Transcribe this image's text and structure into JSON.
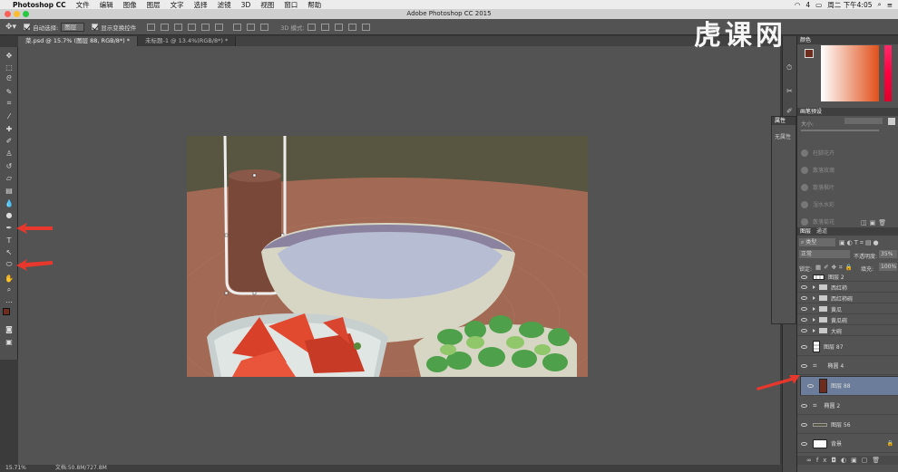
{
  "menubar": {
    "app": "Photoshop CC",
    "items": [
      "文件",
      "编辑",
      "图像",
      "图层",
      "文字",
      "选择",
      "滤镜",
      "3D",
      "视图",
      "窗口",
      "帮助"
    ],
    "status_icon_label": "4",
    "clock": "周二 下午4:05"
  },
  "window": {
    "title": "Adobe Photoshop CC 2015"
  },
  "options": {
    "auto_select_label": "自动选择:",
    "auto_select_value": "图层",
    "show_transform_label": "显示变换控件",
    "mode_3d_label": "3D 模式:"
  },
  "tabs": [
    {
      "label": "菜.psd @ 15.7% (图层 88, RGB/8*) *"
    },
    {
      "label": "未标题-1 @ 13.4%(RGB/8*) *"
    }
  ],
  "status": {
    "zoom": "15.71%",
    "doc": "文档:50.8M/727.8M"
  },
  "watermark": {
    "text": "虎课网"
  },
  "panels": {
    "color_tab": "颜色",
    "brush_preset_tab": "画笔预设",
    "size_label": "大小:",
    "brush_presets": [
      "柱脚花卉",
      "散落玫瑰",
      "散落枫叶",
      "湿水水彩",
      "散落菊花"
    ],
    "properties_tab": "属性",
    "properties_empty": "无属性",
    "layers_tab": "图层",
    "channels_tab": "通道",
    "kind_label": "类型",
    "blend_mode": "正常",
    "opacity_label": "不透明度:",
    "opacity_value": "35%",
    "lock_label": "锁定:",
    "fill_label": "填充:",
    "fill_value": "100%"
  },
  "layers": [
    {
      "name": "图层 2",
      "type": "layer"
    },
    {
      "name": "西红柿",
      "type": "group"
    },
    {
      "name": "西红柿碗",
      "type": "group"
    },
    {
      "name": "黄瓜",
      "type": "group"
    },
    {
      "name": "黄瓜碗",
      "type": "group"
    },
    {
      "name": "大碗",
      "type": "group"
    },
    {
      "name": "图层 87",
      "type": "layer"
    },
    {
      "name": "椭圆 4",
      "type": "shape"
    },
    {
      "name": "图层 88",
      "type": "layer",
      "selected": true
    },
    {
      "name": "椭圆 2",
      "type": "shape"
    },
    {
      "name": "图层 56",
      "type": "layer"
    },
    {
      "name": "背景",
      "type": "background"
    }
  ],
  "colors": {
    "accent_arrow": "#e8372c",
    "selected_layer": "#6b7d9a",
    "foreground": "#6e2c1e"
  }
}
